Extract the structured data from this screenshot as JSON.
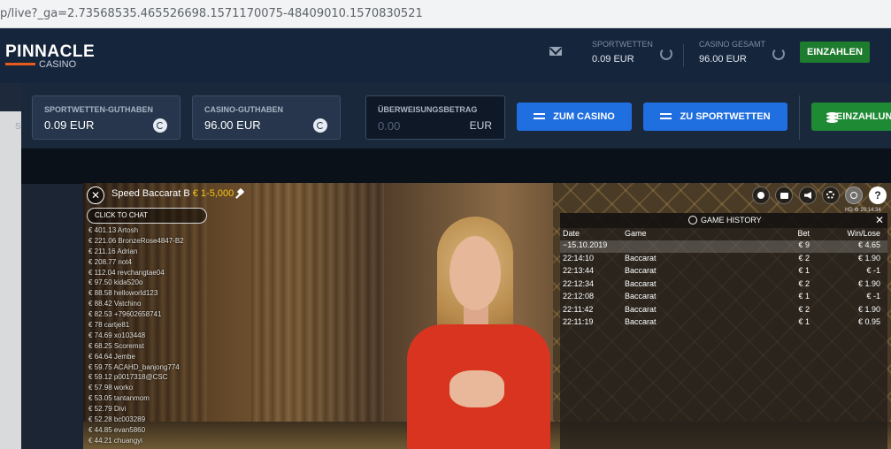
{
  "browser": {
    "url": "p/live?_ga=2.73568535.465526698.1571170075-48409010.1570830521"
  },
  "header": {
    "logo_main": "PINNACLE",
    "logo_sub": "CASINO",
    "sportwetten_label": "SPORTWETTEN",
    "sportwetten_value": "0.09 EUR",
    "casino_gesamt_label": "CASINO GESAMT",
    "casino_gesamt_value": "96.00 EUR",
    "einzahlen_label": "EINZAHLEN"
  },
  "transfer": {
    "sport_label": "SPORTWETTEN-GUTHABEN",
    "sport_value": "0.09 EUR",
    "casino_label": "CASINO-GUTHABEN",
    "casino_value": "96.00 EUR",
    "amount_label": "ÜBERWEISUNGSBETRAG",
    "amount_placeholder": "0.00",
    "amount_currency": "EUR",
    "to_casino_label": "ZUM CASINO",
    "to_sports_label": "ZU SPORTWETTEN",
    "deposit_label": "EINZAHLUNG"
  },
  "sidebar": {
    "letter": "S"
  },
  "video": {
    "table_name": "Speed Baccarat B",
    "table_limit": "€ 1-5,000",
    "chat_label": "CLICK TO CHAT",
    "hd_time": "HD  ⚙ 20:14:34",
    "winners": [
      "€ 401.13 Artosh",
      "€ 221.06 BronzeRose4847-B2",
      "€ 211.16 Adrian",
      "€ 208.77 not4",
      "€ 112.04 revchangtae04",
      "€ 97.50 kida520o",
      "€ 88.58 helloworld123",
      "€ 88.42 Vatchino",
      "€ 82.53 +79602658741",
      "€ 78 cartje81",
      "€ 74.69 xo103448",
      "€ 68.25 Scoremst",
      "€ 64.64 Jembe",
      "€ 59.75 ACAHD_banjong774",
      "€ 59.12 p0017318@CSC",
      "€ 57.98 worko",
      "€ 53.05 tantanmom",
      "€ 52.79 Divi",
      "€ 52.28 bc003289",
      "€ 44.85 evan5860",
      "€ 44.21 chuangyi"
    ]
  },
  "history": {
    "title": "GAME HISTORY",
    "col_date": "Date",
    "col_game": "Game",
    "col_bet": "Bet",
    "col_winlose": "Win/Lose",
    "summary": {
      "date": "−15.10.2019",
      "game": "",
      "bet": "€ 9",
      "win": "€ 4.65"
    },
    "rows": [
      {
        "time": "22:14:10",
        "game": "Baccarat",
        "bet": "€ 2",
        "win": "€ 1.90"
      },
      {
        "time": "22:13:44",
        "game": "Baccarat",
        "bet": "€ 1",
        "win": "€ -1"
      },
      {
        "time": "22:12:34",
        "game": "Baccarat",
        "bet": "€ 2",
        "win": "€ 1.90"
      },
      {
        "time": "22:12:08",
        "game": "Baccarat",
        "bet": "€ 1",
        "win": "€ -1"
      },
      {
        "time": "22:11:42",
        "game": "Baccarat",
        "bet": "€ 2",
        "win": "€ 1.90"
      },
      {
        "time": "22:11:19",
        "game": "Baccarat",
        "bet": "€ 1",
        "win": "€ 0.95"
      }
    ]
  },
  "colors": {
    "primary_blue": "#1f6fe0",
    "deposit_green": "#1f8a34",
    "limit_yellow": "#f5c518",
    "header_bg": "#15253c"
  }
}
